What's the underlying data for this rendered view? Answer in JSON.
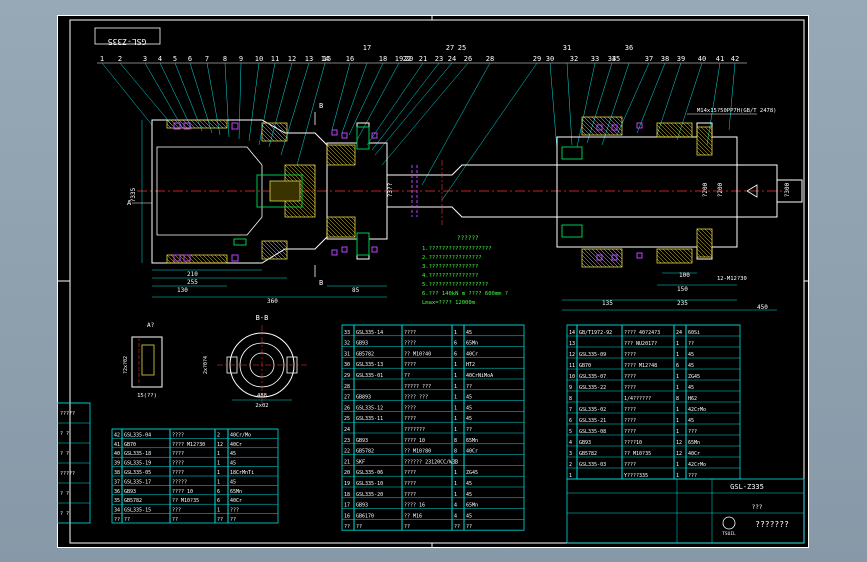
{
  "drawing": {
    "code_box": "GSL-Z335",
    "drawing_number": "GSL-Z335",
    "scale_note": "???",
    "company_label": "???????",
    "logo_text": "TSUIL",
    "thread_note": "M14x15?50PP7H(GB/T 2478)",
    "view_a_label": "A",
    "view_section_label": "B",
    "detail_a_label": "A?",
    "section_bb_label": "B-B",
    "detail_dims": [
      "15(??)",
      "?2x?02",
      "2x?0?4",
      "488",
      "2x02"
    ],
    "dims_main": [
      "210",
      "255",
      "130",
      "360",
      "85",
      "135",
      "235",
      "150",
      "100",
      "450",
      "12-M12?30"
    ],
    "dims_vertical": [
      "?335",
      "?200",
      "?200",
      "?3??",
      "?300"
    ],
    "tech_req_title": "??????",
    "tech_req": [
      "1.???????????????????",
      "2.????????????????",
      "3.???????????????",
      "4.???????????????",
      "5.??????????????????",
      "6.??? 140kN m ???? 600mm ?",
      "Lmax=???? 12000m"
    ],
    "balloons": [
      "1",
      "2",
      "3",
      "4",
      "5",
      "6",
      "7",
      "8",
      "9",
      "10",
      "11",
      "12",
      "13",
      "14",
      "15",
      "16",
      "17",
      "18",
      "19",
      "20",
      "21",
      "22",
      "23",
      "24",
      "25",
      "26",
      "27",
      "28",
      "29",
      "30",
      "31",
      "32",
      "33",
      "34",
      "35",
      "36",
      "37",
      "38",
      "39",
      "40",
      "41",
      "42"
    ]
  },
  "parts_list_left": [
    [
      "42",
      "GSL335-04",
      "????",
      "2",
      "40Cr/Mo"
    ],
    [
      "41",
      "GB70",
      "???? M12?30",
      "12",
      "40Cr"
    ],
    [
      "40",
      "GSL335-18",
      "????",
      "1",
      "45"
    ],
    [
      "39",
      "GSL335-19",
      "????",
      "1",
      "45"
    ],
    [
      "38",
      "GSL335-05",
      "????",
      "1",
      "18CrMnTi"
    ],
    [
      "37",
      "GSL335-17",
      "?????",
      "1",
      "45"
    ],
    [
      "36",
      "GB93",
      "???? 10",
      "6",
      "65Mn"
    ],
    [
      "35",
      "GB5782",
      "?? M10?35",
      "6",
      "40Cr"
    ],
    [
      "34",
      "GSL335-15",
      "???",
      "1",
      "???"
    ],
    [
      "??",
      "??",
      "??",
      "??",
      "??"
    ]
  ],
  "parts_list_mid": [
    [
      "33",
      "GSL335-14",
      "????",
      "1",
      "45"
    ],
    [
      "32",
      "GB93",
      "????",
      "6",
      "65Mn"
    ],
    [
      "31",
      "GB5782",
      "?? M10?40",
      "6",
      "40Cr"
    ],
    [
      "30",
      "GSL335-13",
      "????",
      "1",
      "HT2"
    ],
    [
      "29",
      "GSL335-01",
      "??",
      "1",
      "40CrNiMoA"
    ],
    [
      "28",
      "",
      "????? ???",
      "1",
      "??"
    ],
    [
      "27",
      "GB893",
      "???? ???",
      "1",
      "45"
    ],
    [
      "26",
      "GSL335-12",
      "????",
      "1",
      "45"
    ],
    [
      "25",
      "GSL335-11",
      "????",
      "1",
      "45"
    ],
    [
      "24",
      "",
      "???????",
      "1",
      "??"
    ],
    [
      "23",
      "GB93",
      "???? 10",
      "8",
      "65Mn"
    ],
    [
      "22",
      "GB5782",
      "?? M10?80",
      "8",
      "40Cr"
    ],
    [
      "21",
      "SKF",
      "?????? 23120CC/W33",
      "1",
      ""
    ],
    [
      "20",
      "GSL335-06",
      "????",
      "1",
      "ZG45"
    ],
    [
      "19",
      "GSL335-10",
      "????",
      "1",
      "45"
    ],
    [
      "18",
      "GSL335-20",
      "????",
      "1",
      "45"
    ],
    [
      "17",
      "GB93",
      "???? 16",
      "4",
      "65Mn"
    ],
    [
      "16",
      "GB6170",
      "?? M16",
      "4",
      "45"
    ],
    [
      "??",
      "??",
      "??",
      "??",
      "??"
    ]
  ],
  "parts_list_right": [
    [
      "14",
      "GB/T1972-92",
      "???? 40?24?3",
      "24",
      "60Si"
    ],
    [
      "13",
      "",
      "??? NU2017?",
      "1",
      "??"
    ],
    [
      "12",
      "GSL335-09",
      "????",
      "1",
      "45"
    ],
    [
      "11",
      "GB70",
      "???? M12?48",
      "6",
      "45"
    ],
    [
      "10",
      "GSL335-07",
      "????",
      "1",
      "ZG45"
    ],
    [
      "9",
      "GSL335-22",
      "????",
      "1",
      "45"
    ],
    [
      "8",
      "",
      "1/4??????",
      "8",
      "H62"
    ],
    [
      "7",
      "GSL335-02",
      "????",
      "1",
      "42CrMo"
    ],
    [
      "6",
      "GSL335-21",
      "????",
      "1",
      "45"
    ],
    [
      "5",
      "GSL335-08",
      "????",
      "1",
      "???"
    ],
    [
      "4",
      "GB93",
      "????10",
      "12",
      "65Mn"
    ],
    [
      "3",
      "GB5782",
      "?? M10?35",
      "12",
      "40Cr"
    ],
    [
      "2",
      "GSL335-03",
      "????",
      "1",
      "42CrMo"
    ],
    [
      "1",
      "",
      "Y????335",
      "1",
      "???"
    ]
  ],
  "change_table_rows": [
    "?????",
    "? ?",
    "? ?",
    "?????",
    "? ?",
    "? ?"
  ],
  "colors": {
    "background": "#000000",
    "frame": "#ffffff",
    "table_lines": "#00e0e0",
    "leaders": "#00e0e0",
    "outline": "#ffffff",
    "centerline": "#ff3030",
    "hatch": "#e8d84a",
    "seal": "#c040ff",
    "bearing": "#00c850",
    "text_main": "#ffffff",
    "text_green": "#40ff40",
    "text_yellow": "#ffff40"
  }
}
